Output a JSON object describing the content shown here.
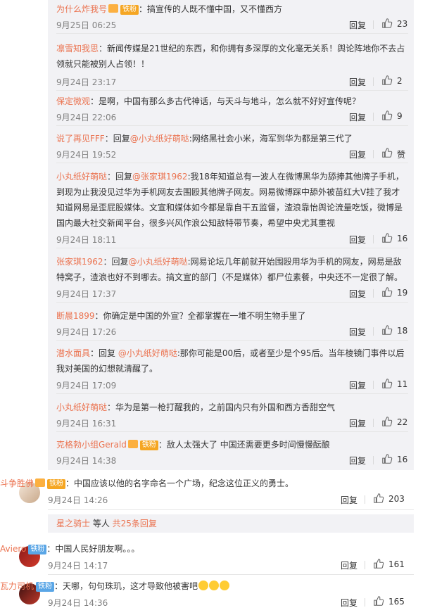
{
  "replies": [
    {
      "user": "为什么炸我号",
      "badge": "铁粉",
      "segments": [
        {
          "t": "：搞宣传的人既不懂中国，又不懂西方",
          "at": false
        }
      ],
      "time": "9月25日 06:25",
      "likes": "23"
    },
    {
      "user": "凛雪知我思",
      "segments": [
        {
          "t": "：新闻传媒是21世纪的东西，和你拥有多深厚的文化毫无关系！舆论阵地你不去占领就只能被别人占领！！",
          "at": false
        }
      ],
      "time": "9月24日 23:17",
      "likes": "2"
    },
    {
      "user": "保定微观",
      "segments": [
        {
          "t": "：是啊，中国有那么多古代神话，与天斗与地斗，怎么就不好好宣传呢？",
          "at": false
        }
      ],
      "time": "9月24日 22:06",
      "likes": "9"
    },
    {
      "user": "说了再见FFF",
      "segments": [
        {
          "t": "：回复",
          "at": false
        },
        {
          "t": "@小丸纸好萌哒",
          "at": true
        },
        {
          "t": ":网络黑社会小米，海军到华为都是第三代了",
          "at": false
        }
      ],
      "time": "9月24日 19:52",
      "likes": "赞"
    },
    {
      "user": "小丸纸好萌哒",
      "segments": [
        {
          "t": "：回复",
          "at": false
        },
        {
          "t": "@张家琪1962",
          "at": true
        },
        {
          "t": ":我18年知道总有一波人在微博黑华为舔捧其他牌子手机，到现为止我没见过华为手机网友去围殴其他牌子网友。网易微博踩中舔外被苗红大V挂了我才知道网易是歪屁股媒体。文宣和媒体如今都是靠自干五监督，渣浪靠怡舆论流量吃饭，微博是国内最大社交新闻平台，很多兴风作浪公知敌特带节奏，希望中央尤其重视",
          "at": false
        }
      ],
      "time": "9月24日 18:11",
      "likes": "16"
    },
    {
      "user": "张家琪1962",
      "segments": [
        {
          "t": "：回复",
          "at": false
        },
        {
          "t": "@小丸纸好萌哒",
          "at": true
        },
        {
          "t": ":网易论坛几年前就开始围殴用华为手机的网友，网易是敌特窝子，渣浪也好不到哪去。搞文宣的部门（不是媒体）都尸位素餐，中央还不一定很了解。",
          "at": false
        }
      ],
      "time": "9月24日 17:37",
      "likes": "19"
    },
    {
      "user": "断晨1899",
      "segments": [
        {
          "t": "：你确定是中国的外宣？全都掌握在一堆不明生物手里了",
          "at": false
        }
      ],
      "time": "9月24日 17:26",
      "likes": "18"
    },
    {
      "user": "潜水面具",
      "segments": [
        {
          "t": "：回复 ",
          "at": false
        },
        {
          "t": "@小丸纸好萌哒",
          "at": true
        },
        {
          "t": ":那你可能是00后，或者至少是个95后。当年棱镜门事件以后我对美国的幻想就清醒了。",
          "at": false
        }
      ],
      "time": "9月24日 17:09",
      "likes": "11"
    },
    {
      "user": "小丸纸好萌哒",
      "segments": [
        {
          "t": "：华为是第一枪打醒我的，之前国内只有外国和西方香甜空气",
          "at": false
        }
      ],
      "time": "9月24日 16:31",
      "likes": "22"
    },
    {
      "user": "克格勃小组Gerald",
      "badge": "铁粉",
      "segments": [
        {
          "t": "：敌人太强大了 中国还需要更多时间慢慢酝酿",
          "at": false
        }
      ],
      "time": "9月24日 14:38",
      "likes": "16"
    }
  ],
  "comments": [
    {
      "user": "斗争胜佛",
      "badge": "铁粉",
      "text": "：中国应该以他的名字命名一个广场，纪念这位正义的勇士。",
      "time": "9月24日 14:26",
      "likes": "203"
    },
    {
      "user": "Aviero",
      "badge": "铁粉",
      "text": "：中国人民好朋友啊。。。",
      "time": "9月24日 14:17",
      "likes": "161"
    },
    {
      "user": "瓦力司机",
      "badge": "铁粉",
      "text": "：天哪，句句珠玑，这才导致他被害吧",
      "time": "9月24日 14:36",
      "likes": "165"
    }
  ],
  "more": {
    "who": "星之骑士",
    "mid": " 等人 ",
    "count": "共25条回复"
  },
  "labels": {
    "reply": "回复"
  },
  "colors": {
    "name": "#eb7350",
    "accent": "#f5a623",
    "panel": "#f2f2f5"
  }
}
